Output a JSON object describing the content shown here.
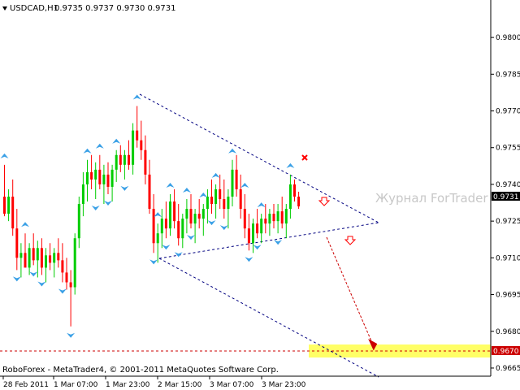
{
  "window": {
    "symbol": "USDCAD,H1",
    "ohlc": "0.9735 0.9737 0.9730 0.9731",
    "watermark": "Журнал ForTrader",
    "footer": "RoboForex - MetaTrader4, © 2001-2011 MetaQuotes Software Corp."
  },
  "colors": {
    "bull": "#00cc00",
    "bear": "#ff0000",
    "fractal": "#3aa0e6",
    "pattern_line": "#000080",
    "target_zone": "#ffff66",
    "target_line": "#cc0000"
  },
  "price_axis": {
    "labels": [
      "0.9800",
      "0.9785",
      "0.9770",
      "0.9755",
      "0.9740",
      "0.9725",
      "0.9710",
      "0.9695",
      "0.9680",
      "0.9665"
    ],
    "current_price": "0.9731",
    "target_price": "0.9670"
  },
  "time_axis": {
    "labels": [
      "28 Feb 2011",
      "1 Mar 07:00",
      "1 Mar 23:00",
      "2 Mar 15:00",
      "3 Mar 07:00",
      "3 Mar 23:00"
    ]
  },
  "chart_data": {
    "type": "candlestick",
    "symbol": "USDCAD",
    "timeframe": "H1",
    "ylim": [
      0.9662,
      0.9808
    ],
    "candles": [
      [
        0.9735,
        0.9748,
        0.9727,
        0.9728
      ],
      [
        0.9728,
        0.9738,
        0.9725,
        0.9735
      ],
      [
        0.9735,
        0.9742,
        0.9719,
        0.9722
      ],
      [
        0.9722,
        0.973,
        0.9705,
        0.971
      ],
      [
        0.971,
        0.9716,
        0.9702,
        0.9712
      ],
      [
        0.9712,
        0.972,
        0.9708,
        0.9706
      ],
      [
        0.9706,
        0.9716,
        0.9703,
        0.9714
      ],
      [
        0.9714,
        0.972,
        0.9707,
        0.9709
      ],
      [
        0.9709,
        0.9717,
        0.9702,
        0.9714
      ],
      [
        0.9714,
        0.9718,
        0.9703,
        0.9706
      ],
      [
        0.9706,
        0.9714,
        0.97,
        0.9711
      ],
      [
        0.9711,
        0.9716,
        0.9705,
        0.9708
      ],
      [
        0.9708,
        0.9714,
        0.9702,
        0.9712
      ],
      [
        0.9712,
        0.9718,
        0.9706,
        0.9709
      ],
      [
        0.9709,
        0.9716,
        0.97,
        0.9704
      ],
      [
        0.9704,
        0.971,
        0.9697,
        0.97
      ],
      [
        0.97,
        0.9705,
        0.9682,
        0.9698
      ],
      [
        0.9698,
        0.972,
        0.9695,
        0.9718
      ],
      [
        0.9718,
        0.9735,
        0.9714,
        0.9732
      ],
      [
        0.9732,
        0.9745,
        0.9727,
        0.974
      ],
      [
        0.974,
        0.975,
        0.9733,
        0.9745
      ],
      [
        0.9745,
        0.9752,
        0.9738,
        0.9742
      ],
      [
        0.9742,
        0.9749,
        0.9734,
        0.9746
      ],
      [
        0.9746,
        0.9752,
        0.9738,
        0.974
      ],
      [
        0.974,
        0.9748,
        0.9732,
        0.9744
      ],
      [
        0.9744,
        0.9749,
        0.9736,
        0.9739
      ],
      [
        0.9739,
        0.9748,
        0.9733,
        0.9746
      ],
      [
        0.9746,
        0.9754,
        0.9741,
        0.9752
      ],
      [
        0.9752,
        0.9756,
        0.9745,
        0.9748
      ],
      [
        0.9748,
        0.9754,
        0.9742,
        0.9752
      ],
      [
        0.9752,
        0.9758,
        0.9746,
        0.9748
      ],
      [
        0.9748,
        0.9765,
        0.9744,
        0.9762
      ],
      [
        0.9762,
        0.9772,
        0.9755,
        0.9758
      ],
      [
        0.9758,
        0.9766,
        0.975,
        0.9754
      ],
      [
        0.9754,
        0.976,
        0.974,
        0.9744
      ],
      [
        0.9744,
        0.975,
        0.9728,
        0.973
      ],
      [
        0.973,
        0.9736,
        0.9712,
        0.9716
      ],
      [
        0.9716,
        0.9724,
        0.9708,
        0.972
      ],
      [
        0.972,
        0.973,
        0.9714,
        0.9726
      ],
      [
        0.9726,
        0.9733,
        0.9718,
        0.9722
      ],
      [
        0.9722,
        0.9736,
        0.9719,
        0.9733
      ],
      [
        0.9733,
        0.9738,
        0.9722,
        0.9725
      ],
      [
        0.9725,
        0.9732,
        0.9715,
        0.9718
      ],
      [
        0.9718,
        0.9728,
        0.9714,
        0.9726
      ],
      [
        0.9726,
        0.9734,
        0.972,
        0.973
      ],
      [
        0.973,
        0.9736,
        0.9722,
        0.9724
      ],
      [
        0.9724,
        0.973,
        0.9716,
        0.9728
      ],
      [
        0.9728,
        0.9734,
        0.9722,
        0.9726
      ],
      [
        0.9726,
        0.9732,
        0.9719,
        0.973
      ],
      [
        0.973,
        0.9738,
        0.9724,
        0.9735
      ],
      [
        0.9735,
        0.9742,
        0.9728,
        0.9732
      ],
      [
        0.9732,
        0.974,
        0.9726,
        0.9738
      ],
      [
        0.9738,
        0.9744,
        0.973,
        0.9734
      ],
      [
        0.9734,
        0.9742,
        0.9726,
        0.973
      ],
      [
        0.973,
        0.9738,
        0.9722,
        0.9735
      ],
      [
        0.9735,
        0.975,
        0.9731,
        0.9746
      ],
      [
        0.9746,
        0.9752,
        0.9735,
        0.9738
      ],
      [
        0.9738,
        0.9744,
        0.9726,
        0.973
      ],
      [
        0.973,
        0.9736,
        0.9718,
        0.9722
      ],
      [
        0.9722,
        0.9728,
        0.9713,
        0.9716
      ],
      [
        0.9716,
        0.9726,
        0.9712,
        0.9724
      ],
      [
        0.9724,
        0.973,
        0.9718,
        0.972
      ],
      [
        0.972,
        0.9728,
        0.9716,
        0.9726
      ],
      [
        0.9726,
        0.9732,
        0.972,
        0.9724
      ],
      [
        0.9724,
        0.973,
        0.9719,
        0.9728
      ],
      [
        0.9728,
        0.9732,
        0.9722,
        0.9725
      ],
      [
        0.9725,
        0.9732,
        0.972,
        0.9729
      ],
      [
        0.9729,
        0.9735,
        0.9722,
        0.9724
      ],
      [
        0.9724,
        0.9732,
        0.9718,
        0.973
      ],
      [
        0.973,
        0.9744,
        0.9726,
        0.974
      ],
      [
        0.974,
        0.9742,
        0.9733,
        0.9735
      ],
      [
        0.9735,
        0.9737,
        0.973,
        0.9731
      ]
    ],
    "annotations": [
      {
        "type": "triangle-pattern",
        "lines": 3
      },
      {
        "type": "target-level",
        "value": 0.967
      },
      {
        "type": "forecast-arrow",
        "to": 0.967
      }
    ]
  }
}
